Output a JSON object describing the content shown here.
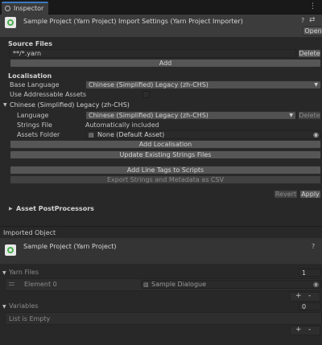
{
  "tab": {
    "label": "Inspector",
    "menu_icon": "kebab-menu-icon"
  },
  "header": {
    "title": "Sample Project (Yarn Project) Import Settings (Yarn Project Importer)",
    "open_label": "Open",
    "help_icon": "help-icon",
    "settings_icon": "settings-sliders-icon"
  },
  "source_files": {
    "heading": "Source Files",
    "value": "**/*.yarn",
    "delete_label": "Delete",
    "add_label": "Add"
  },
  "localisation": {
    "heading": "Localisation",
    "base_language_label": "Base Language",
    "base_language_value": "Chinese (Simplified) Legacy (zh-CHS)",
    "addressable_label": "Use Addressable Assets",
    "addressable_checked": false,
    "entry_heading": "Chinese (Simplified) Legacy (zh-CHS)",
    "language_label": "Language",
    "language_value": "Chinese (Simplified) Legacy (zh-CHS)",
    "language_delete_label": "Delete",
    "strings_label": "Strings File",
    "strings_value": "Automatically included",
    "assets_label": "Assets Folder",
    "assets_value": "None (Default Asset)",
    "add_localisation_label": "Add Localisation",
    "update_strings_label": "Update Existing Strings Files"
  },
  "actions": {
    "add_line_tags_label": "Add Line Tags to Scripts",
    "export_label": "Export Strings and Metadata as CSV",
    "revert_label": "Revert",
    "apply_label": "Apply"
  },
  "postprocessors": {
    "label": "Asset PostProcessors"
  },
  "imported": {
    "section_label": "Imported Object",
    "title": "Sample Project (Yarn Project)",
    "yarn_files_label": "Yarn Files",
    "yarn_files_count": "1",
    "element_label": "Element 0",
    "element_value": "Sample Dialogue",
    "variables_label": "Variables",
    "variables_count": "0",
    "empty_label": "List is Empty",
    "plus": "+",
    "minus": "-"
  }
}
